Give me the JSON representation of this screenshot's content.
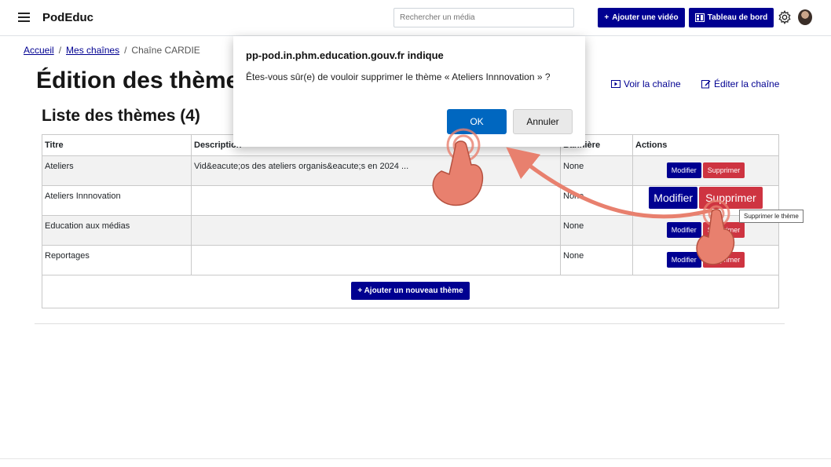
{
  "header": {
    "brand": "PodEduc",
    "search_placeholder": "Rechercher un média",
    "add_video_label": "Ajouter une vidéo",
    "dashboard_label": "Tableau de bord"
  },
  "breadcrumb": {
    "home": "Accueil",
    "sep1": "/",
    "channels": "Mes chaînes",
    "sep2": "/",
    "current": "Chaîne CARDIE"
  },
  "page": {
    "title": "Édition des thèmes",
    "view_channel": "Voir la chaîne",
    "edit_channel": "Éditer la chaîne",
    "list_title": "Liste des thèmes (4)"
  },
  "table": {
    "headers": [
      "Titre",
      "Description",
      "Bannière",
      "Actions"
    ],
    "rows": [
      {
        "title": "Ateliers",
        "description": "Vid&eacute;os des ateliers organis&eacute;s en 2024 ...",
        "banner": "None"
      },
      {
        "title": "Ateliers Innnovation",
        "description": "",
        "banner": "None"
      },
      {
        "title": "Education aux médias",
        "description": "",
        "banner": "None"
      },
      {
        "title": "Reportages",
        "description": "",
        "banner": "None"
      }
    ],
    "modify_label": "Modifier",
    "delete_label": "Supprimer",
    "add_theme_label": "Ajouter un nouveau thème"
  },
  "tooltip": "Supprimer le thème",
  "dialog": {
    "title": "pp-pod.in.phm.education.gouv.fr indique",
    "message": "Êtes-vous sûr(e) de vouloir supprimer le thème « Ateliers Innnovation » ?",
    "ok_label": "OK",
    "cancel_label": "Annuler"
  },
  "colors": {
    "primary": "#000091",
    "danger": "#ce3441",
    "dialog_ok": "#0067c0",
    "annotation": "#e8806e"
  },
  "icons": [
    "menu-icon",
    "plus-icon",
    "dashboard-icon",
    "gear-icon",
    "avatar",
    "video-icon",
    "edit-icon",
    "hand-pointer-icon"
  ]
}
